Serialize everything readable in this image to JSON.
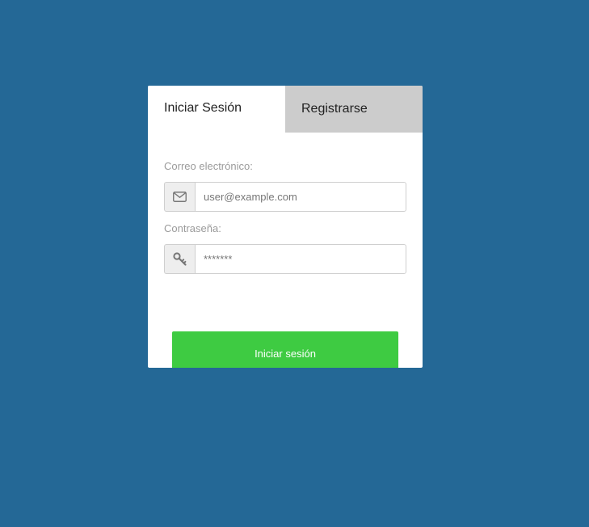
{
  "tabs": {
    "login_label": "Iniciar Sesión",
    "register_label": "Registrarse"
  },
  "login_form": {
    "email_label": "Correo electrónico:",
    "email_placeholder": "user@example.com",
    "email_icon": "envelope-icon",
    "password_label": "Contraseña:",
    "password_placeholder": "*******",
    "password_icon": "key-icon",
    "submit_label": "Iniciar sesión"
  },
  "colors": {
    "background": "#246896",
    "card": "#ffffff",
    "inactive_tab": "#cccccc",
    "submit_button": "#3ecb42"
  }
}
